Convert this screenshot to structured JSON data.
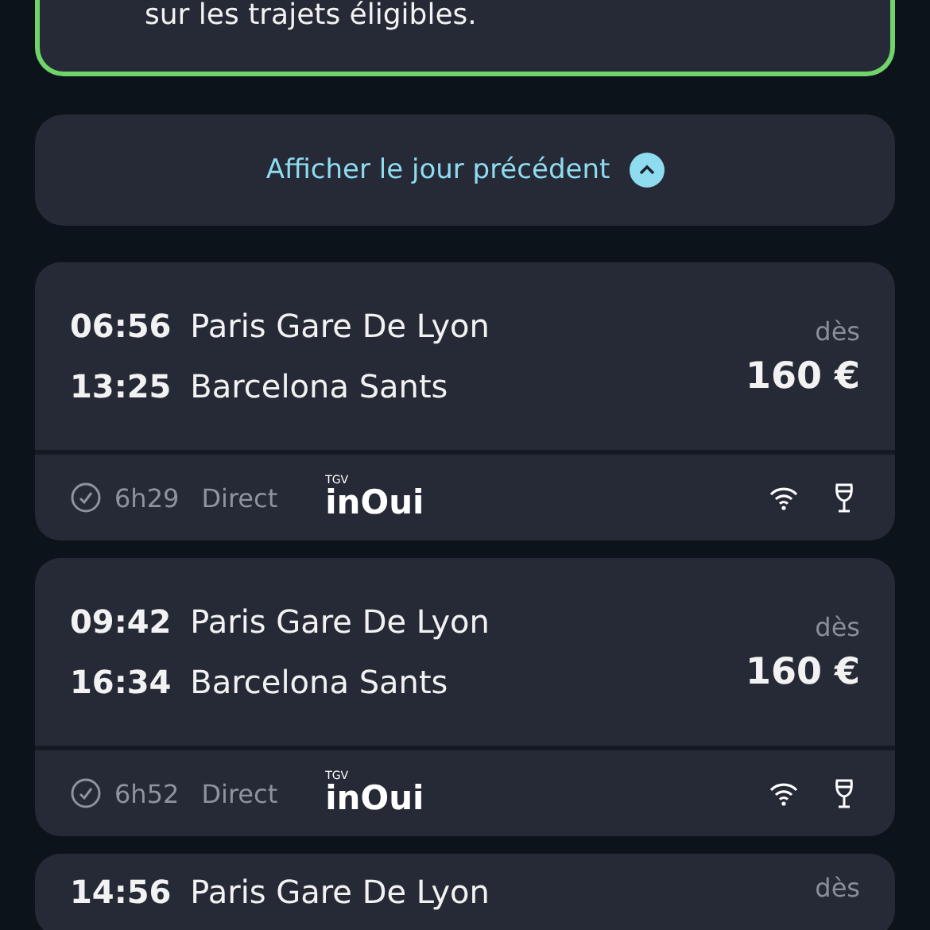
{
  "banner": {
    "text": "sur les trajets éligibles."
  },
  "previous_day": {
    "label": "Afficher le jour précédent"
  },
  "trips": [
    {
      "departure_time": "06:56",
      "departure_station": "Paris Gare De Lyon",
      "arrival_time": "13:25",
      "arrival_station": "Barcelona Sants",
      "price_prefix": "dès",
      "price": "160 €",
      "duration": "6h29",
      "type": "Direct",
      "operator_small": "TGV",
      "operator": "inOui",
      "wifi": true,
      "bar": true
    },
    {
      "departure_time": "09:42",
      "departure_station": "Paris Gare De Lyon",
      "arrival_time": "16:34",
      "arrival_station": "Barcelona Sants",
      "price_prefix": "dès",
      "price": "160 €",
      "duration": "6h52",
      "type": "Direct",
      "operator_small": "TGV",
      "operator": "inOui",
      "wifi": true,
      "bar": true
    },
    {
      "departure_time": "14:56",
      "departure_station": "Paris Gare De Lyon",
      "price_prefix": "dès"
    }
  ]
}
